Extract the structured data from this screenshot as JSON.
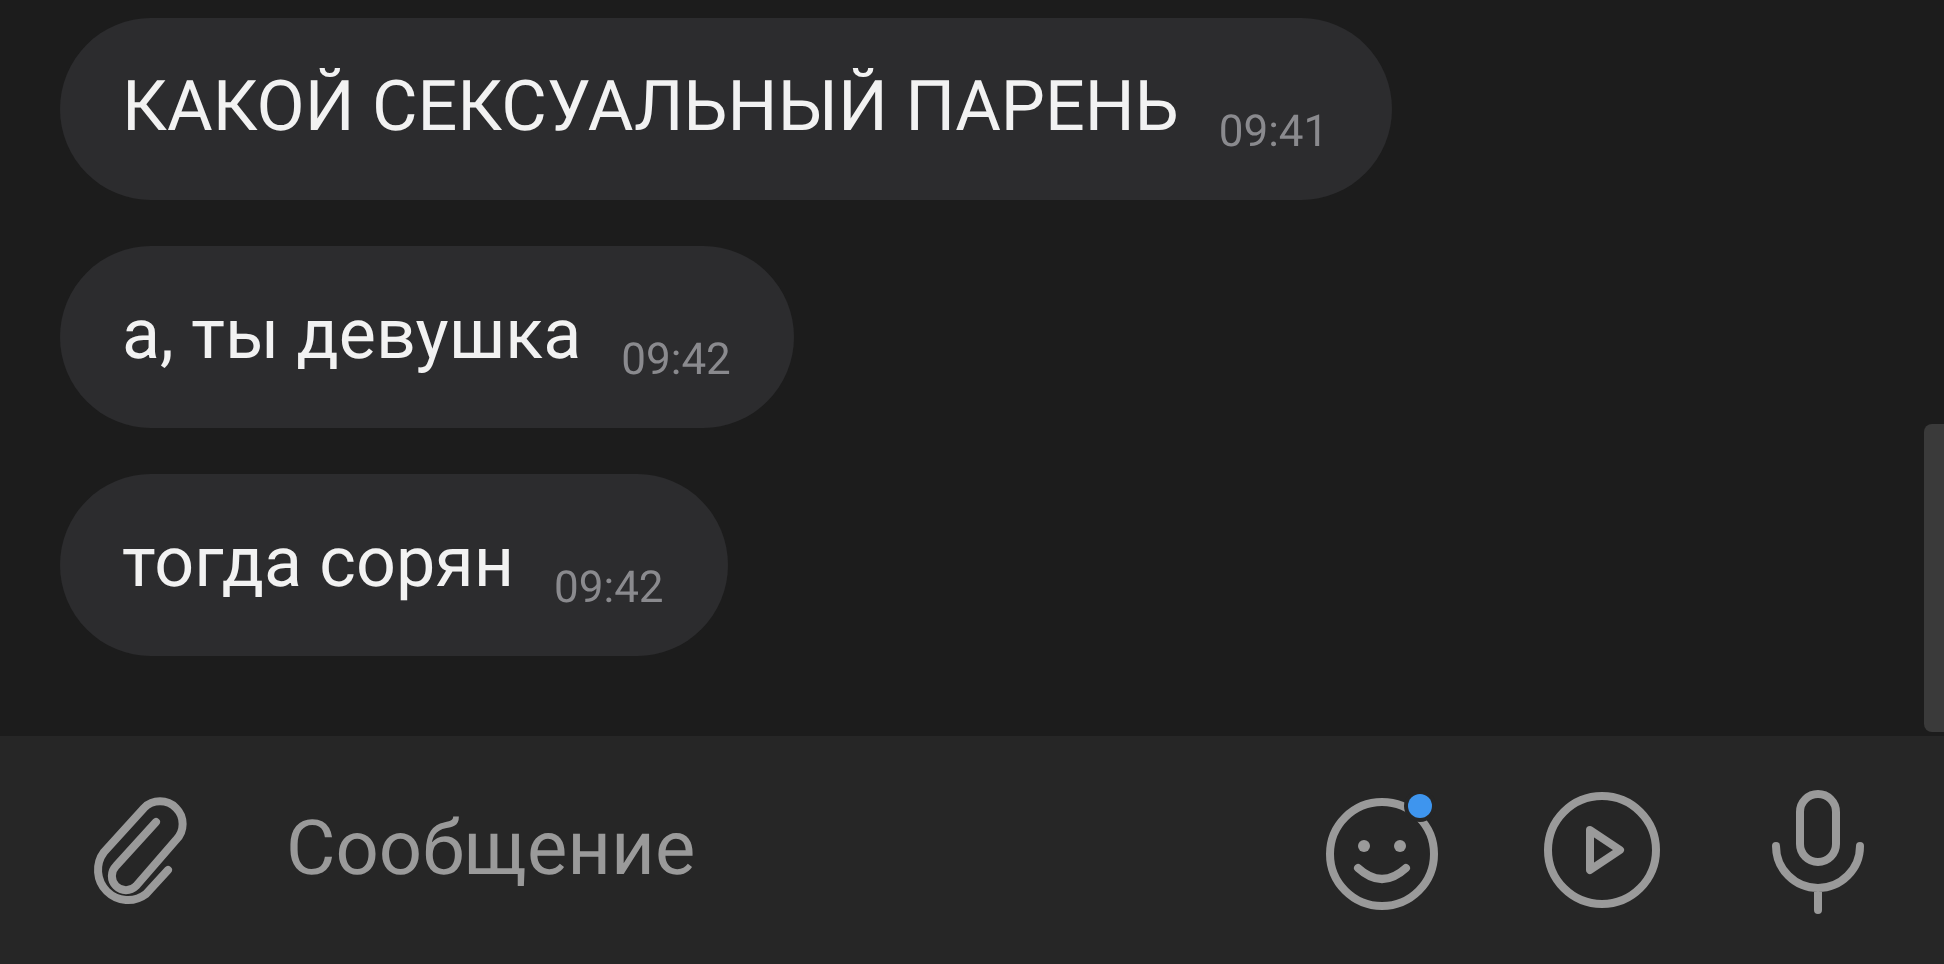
{
  "messages": [
    {
      "text": "КАКОЙ СЕКСУАЛЬНЫЙ ПАРЕНЬ",
      "time": "09:41"
    },
    {
      "text": "а, ты девушка",
      "time": "09:42"
    },
    {
      "text": "тогда сорян",
      "time": "09:42"
    }
  ],
  "composer": {
    "placeholder": "Сообщение"
  }
}
